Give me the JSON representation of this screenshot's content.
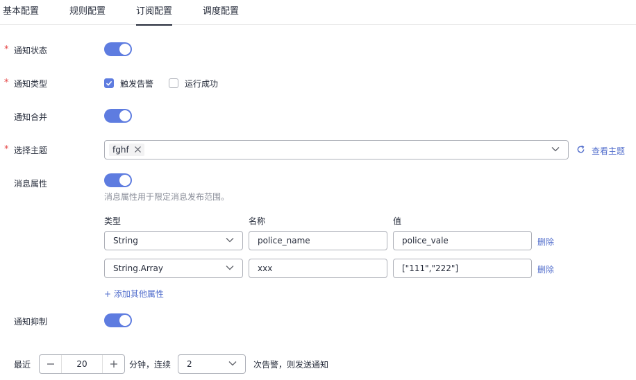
{
  "tabs": [
    "基本配置",
    "规则配置",
    "订阅配置",
    "调度配置"
  ],
  "colors": {
    "accent": "#5e7ce0",
    "link": "#526ecc",
    "required": "#e54545",
    "hint": "#8a8e99"
  },
  "notify_status": {
    "label": "通知状态",
    "required_mark": "*",
    "enabled": true
  },
  "notify_type": {
    "label": "通知类型",
    "required_mark": "*",
    "options": [
      {
        "label": "触发告警",
        "checked": true
      },
      {
        "label": "运行成功",
        "checked": false
      }
    ]
  },
  "notify_merge": {
    "label": "通知合并",
    "enabled": true
  },
  "topic": {
    "label": "选择主题",
    "required_mark": "*",
    "selected_tag": "fghf",
    "view_link": "查看主题"
  },
  "message_attrs": {
    "label": "消息属性",
    "enabled": true,
    "hint": "消息属性用于限定消息发布范围。",
    "headers": {
      "type": "类型",
      "name": "名称",
      "value": "值"
    },
    "rows": [
      {
        "type": "String",
        "name": "police_name",
        "value": "police_vale",
        "delete": "删除"
      },
      {
        "type": "String.Array",
        "name": "xxx",
        "value": "[\"111\",\"222\"]",
        "delete": "删除"
      }
    ],
    "add_link": "+ 添加其他属性"
  },
  "notify_suppress": {
    "label": "通知抑制",
    "enabled": true,
    "prefix": "最近",
    "minutes": "20",
    "mid_text": "分钟，连续",
    "count": "2",
    "suffix": "次告警，则发送通知"
  }
}
